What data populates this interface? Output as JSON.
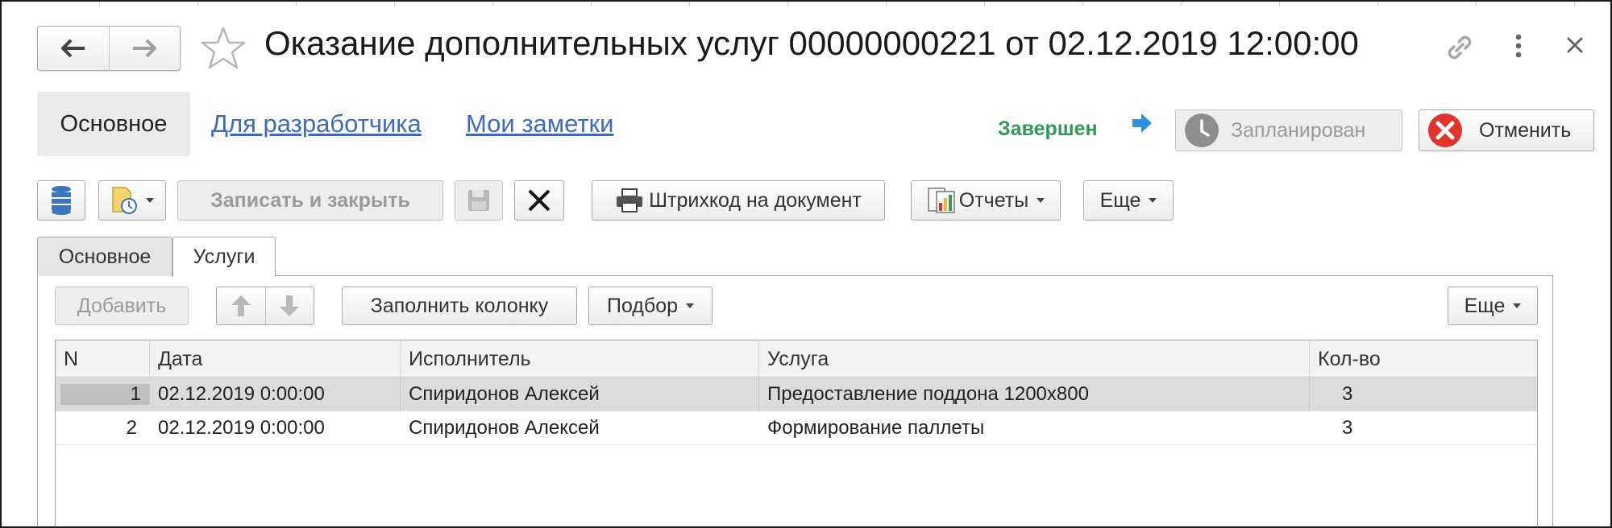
{
  "window": {
    "title": "Оказание дополнительных услуг 00000000221 от 02.12.2019 12:00:00"
  },
  "sections": {
    "main": "Основное",
    "developer": "Для разработчика",
    "notes": "Мои заметки"
  },
  "status": {
    "current": "Завершен",
    "planned_label": "Запланирован",
    "cancel_label": "Отменить"
  },
  "toolbar": {
    "save_close": "Записать и закрыть",
    "barcode": "Штрихкод на документ",
    "reports": "Отчеты",
    "more": "Еще"
  },
  "tabs": {
    "main": "Основное",
    "services": "Услуги"
  },
  "table_toolbar": {
    "add": "Добавить",
    "fill_column": "Заполнить колонку",
    "selection": "Подбор",
    "more": "Еще"
  },
  "table": {
    "columns": [
      "N",
      "Дата",
      "Исполнитель",
      "Услуга",
      "Кол-во"
    ],
    "rows": [
      {
        "n": "1",
        "date": "02.12.2019 0:00:00",
        "executor": "Спиридонов Алексей",
        "service": "Предоставление поддона 1200х800",
        "qty": "3"
      },
      {
        "n": "2",
        "date": "02.12.2019 0:00:00",
        "executor": "Спиридонов Алексей",
        "service": "Формирование паллеты",
        "qty": "3"
      }
    ]
  },
  "icons": {
    "back": "arrow-left-icon",
    "forward": "arrow-right-icon",
    "favorite": "star-icon",
    "link": "link-icon",
    "menu": "more-vertical-icon",
    "close": "close-icon",
    "status_arrow": "arrow-right-blue-icon",
    "clock": "clock-icon",
    "cancel": "red-x-icon",
    "structure": "document-structure-icon",
    "based_on": "create-based-on-icon",
    "save": "floppy-icon",
    "delete": "delete-x-icon",
    "printer": "printer-icon",
    "reports": "reports-chart-icon",
    "move_up": "arrow-up-icon",
    "move_down": "arrow-down-icon"
  },
  "colors": {
    "status_green": "#2f9a57",
    "link_blue": "#3c6bc4",
    "cancel_red": "#e0342c",
    "selection_gray": "#dcdcdc"
  }
}
